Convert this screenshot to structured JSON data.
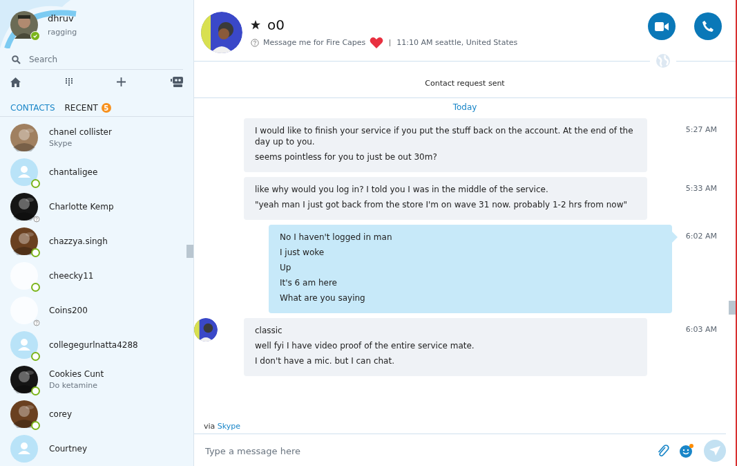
{
  "profile": {
    "name": "dhruv",
    "mood": "ragging",
    "online": true
  },
  "search": {
    "placeholder": "Search"
  },
  "tabs": [
    {
      "label": "CONTACTS",
      "selected": true
    },
    {
      "label": "RECENT",
      "selected": false,
      "badge": "5"
    }
  ],
  "contacts": [
    {
      "name": "chanel collister",
      "mood": "Skype",
      "online": false,
      "presence_unknown": false
    },
    {
      "name": "chantaligee",
      "kind": "default",
      "online": true,
      "presence_unknown": false
    },
    {
      "name": "Charlotte Kemp",
      "online": false,
      "presence_unknown": true
    },
    {
      "name": "chazzya.singh",
      "online": true,
      "presence_unknown": false
    },
    {
      "name": "cheecky11",
      "kind": "blank",
      "online": true,
      "presence_unknown": false
    },
    {
      "name": "Coins200",
      "kind": "blank",
      "online": false,
      "presence_unknown": true
    },
    {
      "name": "collegegurlnatta4288",
      "kind": "default",
      "online": true,
      "presence_unknown": false
    },
    {
      "name": "Cookies Cunt",
      "mood": "Do ketamine",
      "online": true,
      "presence_unknown": false
    },
    {
      "name": "corey",
      "online": true,
      "presence_unknown": false
    },
    {
      "name": "Courtney",
      "kind": "default",
      "online": false,
      "presence_unknown": false
    }
  ],
  "conversation": {
    "name": "o0",
    "favorite": true,
    "mood": "Message me for Fire Capes",
    "local_time": "11:10 AM seattle, United States",
    "notice": "Contact request sent",
    "day": "Today"
  },
  "messages": [
    {
      "sent": false,
      "avatar": false,
      "time": "5:27 AM",
      "lines": [
        "I would like to finish your service if you put the stuff back on the account. At the end of the day up to you.",
        "seems pointless for you to just be out 30m?"
      ]
    },
    {
      "sent": false,
      "avatar": false,
      "time": "5:33 AM",
      "lines": [
        "like why would you log in? I told you I was in the middle of the service.",
        "\"yeah man I just got back from the store I'm on wave 31 now. probably 1-2 hrs from now\""
      ]
    },
    {
      "sent": true,
      "avatar": false,
      "time": "6:02 AM",
      "lines": [
        "No I haven't logged in man",
        "I just woke",
        "Up",
        "It's 6 am here",
        "What are you saying"
      ]
    },
    {
      "sent": false,
      "avatar": true,
      "time": "6:03 AM",
      "lines": [
        "classic",
        "well fyi I have video proof of the entire service mate.",
        "I don't have a mic. but I can chat."
      ]
    }
  ],
  "via": {
    "prefix": "via",
    "link": "Skype"
  },
  "composer": {
    "placeholder": "Type a message here"
  }
}
